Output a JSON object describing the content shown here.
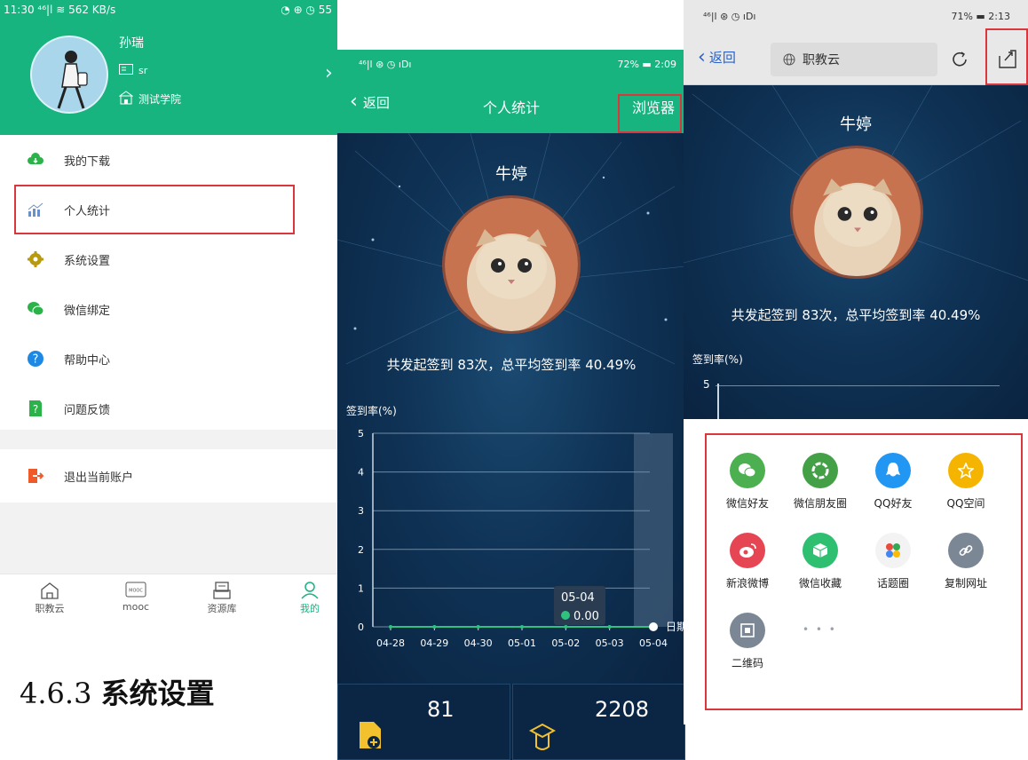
{
  "panel1": {
    "status_left": "11:30 ⁴⁶|l ≋ 562 KB/s",
    "status_right": "◔ ⊕ ◷ 55",
    "user_name": "孙瑞",
    "user_id": "sr",
    "school": "测试学院",
    "menu": [
      {
        "label": "我的下载",
        "icon": "cloud-download-icon",
        "color": "#2bb34a"
      },
      {
        "label": "个人统计",
        "icon": "chart-icon",
        "color": "#6d8fc9"
      },
      {
        "label": "系统设置",
        "icon": "gear-icon",
        "color": "#b89a10"
      },
      {
        "label": "微信绑定",
        "icon": "wechat-icon",
        "color": "#2bb34a"
      },
      {
        "label": "帮助中心",
        "icon": "help-icon",
        "color": "#1e88e5"
      },
      {
        "label": "问题反馈",
        "icon": "feedback-icon",
        "color": "#2bb34a"
      }
    ],
    "logout": "退出当前账户",
    "tabs": [
      {
        "label": "职教云",
        "icon": "home-icon"
      },
      {
        "label": "mooc",
        "icon": "mooc-icon",
        "badge": "MOOC"
      },
      {
        "label": "资源库",
        "icon": "archive-icon"
      },
      {
        "label": "我的",
        "icon": "person-icon"
      }
    ]
  },
  "heading": {
    "number": "4.6.3",
    "title": "系统设置"
  },
  "panel2": {
    "status_left": "⁴⁶|l ⊛ ◷ ıDı",
    "status_right": "72% ▬ 2:09",
    "back": "返回",
    "title": "个人统计",
    "browser": "浏览器",
    "name": "牛婷",
    "summary": "共发起签到 83次，总平均签到率 40.49%",
    "stats": [
      {
        "value": "81",
        "icon": "add-doc-icon"
      },
      {
        "value": "2208",
        "icon": "graduation-icon"
      }
    ]
  },
  "chart_data": {
    "type": "line",
    "ylabel": "签到率(%)",
    "xlabel": "日期",
    "ylim": [
      0,
      5
    ],
    "yticks": [
      "0",
      "1",
      "2",
      "3",
      "4",
      "5"
    ],
    "categories": [
      "04-28",
      "04-29",
      "04-30",
      "05-01",
      "05-02",
      "05-03",
      "05-04"
    ],
    "series": [
      {
        "values": [
          0,
          0,
          0,
          0,
          0,
          0,
          0
        ]
      }
    ],
    "highlight_index": 6,
    "tooltip": {
      "label": "05-04",
      "value": "0.00"
    },
    "color": "#2ec27e"
  },
  "panel3": {
    "status_left": "⁴⁶|l ⊛ ◷ ıDı",
    "status_right": "71% ▬ 2:13",
    "back": "返回",
    "url_title": "职教云",
    "name": "牛婷",
    "summary": "共发起签到 83次，总平均签到率 40.49%",
    "ylabel": "签到率(%)",
    "ytick": "5",
    "share": [
      {
        "label": "微信好友",
        "icon": "wechat-icon",
        "color": "#4caf50"
      },
      {
        "label": "微信朋友圈",
        "icon": "moments-icon",
        "color": "#43a047"
      },
      {
        "label": "QQ好友",
        "icon": "qq-icon",
        "color": "#2196f3"
      },
      {
        "label": "QQ空间",
        "icon": "qzone-icon",
        "color": "#f5b400"
      },
      {
        "label": "新浪微博",
        "icon": "weibo-icon",
        "color": "#e64553"
      },
      {
        "label": "微信收藏",
        "icon": "favorite-icon",
        "color": "#2fbf71"
      },
      {
        "label": "话题圈",
        "icon": "topic-icon",
        "color": "#ffffff"
      },
      {
        "label": "复制网址",
        "icon": "link-icon",
        "color": "#7b8794"
      },
      {
        "label": "二维码",
        "icon": "qrcode-icon",
        "color": "#7b8794"
      }
    ],
    "more": "• • •"
  }
}
